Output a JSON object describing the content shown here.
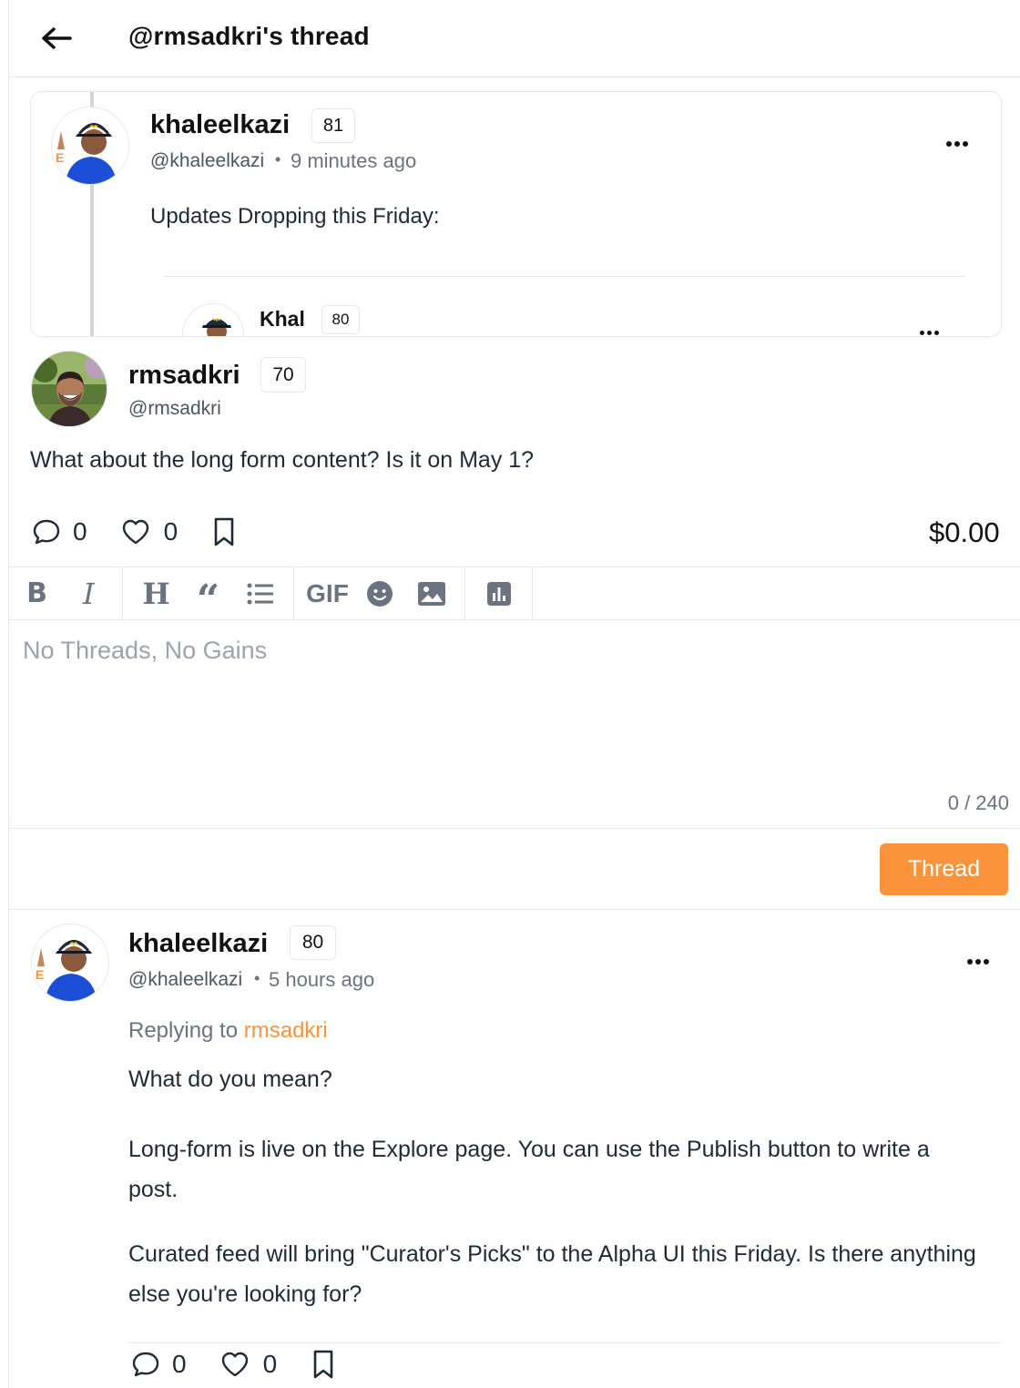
{
  "header": {
    "title": "@rmsadkri's thread"
  },
  "parent_post": {
    "username": "khaleelkazi",
    "reputation": "81",
    "handle": "@khaleelkazi",
    "separator": "•",
    "time": "9 minutes ago",
    "text": "Updates Dropping this Friday:",
    "nested": {
      "username": "Khal",
      "reputation": "80"
    }
  },
  "main_post": {
    "username": "rmsadkri",
    "reputation": "70",
    "handle": "@rmsadkri",
    "text": "What about the long form content? Is it on May 1?",
    "comments": "0",
    "likes": "0",
    "price": "$0.00"
  },
  "editor": {
    "toolbar": [
      "bold",
      "italic",
      "heading",
      "quote",
      "list",
      "GIF",
      "emoji",
      "image",
      "poll"
    ],
    "gif_label": "GIF",
    "placeholder": "No Threads, No Gains",
    "counter": "0 / 240",
    "submit_label": "Thread"
  },
  "reply": {
    "username": "khaleelkazi",
    "reputation": "80",
    "handle": "@khaleelkazi",
    "separator": "•",
    "time": "5 hours ago",
    "replying_prefix": "Replying to ",
    "replying_to": "rmsadkri",
    "paragraphs": [
      "What do you mean?",
      "Long-form is live on the Explore page. You can use the Publish button to write a post.",
      "Curated feed will bring \"Curator's Picks\" to the Alpha UI this Friday. Is there anything else you're looking for?"
    ],
    "comments": "0",
    "likes": "0"
  },
  "colors": {
    "accent": "#fb923c",
    "border": "#e5e7eb",
    "muted": "#6b7280"
  }
}
